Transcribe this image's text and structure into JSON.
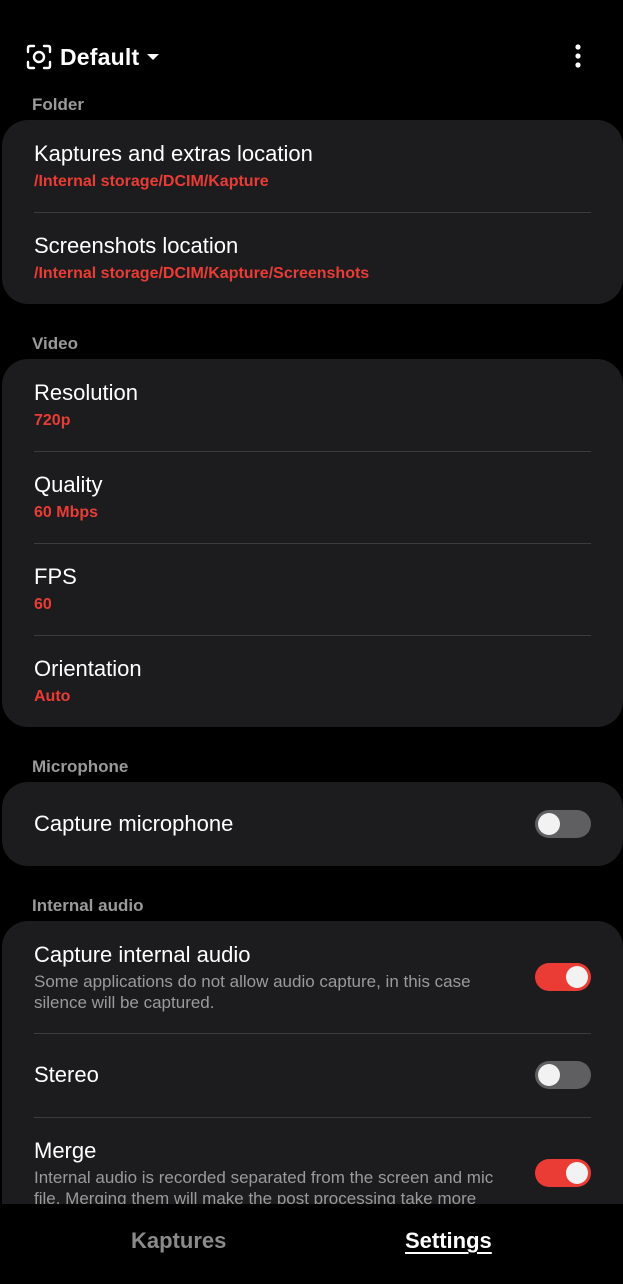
{
  "header": {
    "profile_icon": "scan-frame-icon",
    "profile_title": "Default",
    "dropdown_icon": "caret-down-icon",
    "menu_icon": "more-vertical-icon"
  },
  "sections": {
    "folder": {
      "title": "Folder",
      "items": [
        {
          "title": "Kaptures and extras location",
          "value": "/Internal storage/DCIM/Kapture"
        },
        {
          "title": "Screenshots location",
          "value": "/Internal storage/DCIM/Kapture/Screenshots"
        }
      ]
    },
    "video": {
      "title": "Video",
      "items": [
        {
          "title": "Resolution",
          "value": "720p"
        },
        {
          "title": "Quality",
          "value": "60 Mbps"
        },
        {
          "title": "FPS",
          "value": "60"
        },
        {
          "title": "Orientation",
          "value": "Auto"
        }
      ]
    },
    "microphone": {
      "title": "Microphone",
      "items": [
        {
          "title": "Capture microphone",
          "enabled": false
        }
      ]
    },
    "internal_audio": {
      "title": "Internal audio",
      "items": [
        {
          "title": "Capture internal audio",
          "description": "Some applications do not allow audio capture, in this case silence will be captured.",
          "enabled": true
        },
        {
          "title": "Stereo",
          "enabled": false
        },
        {
          "title": "Merge",
          "description": "Internal audio is recorded separated from the screen and mic file. Merging them will make the post processing take more",
          "enabled": true
        }
      ]
    }
  },
  "bottom_nav": {
    "tabs": [
      {
        "label": "Kaptures",
        "active": false
      },
      {
        "label": "Settings",
        "active": true
      }
    ]
  },
  "colors": {
    "accent": "#ea3c35",
    "card": "#1c1c1e",
    "background": "#000000",
    "muted_text": "#9a9a9a"
  }
}
